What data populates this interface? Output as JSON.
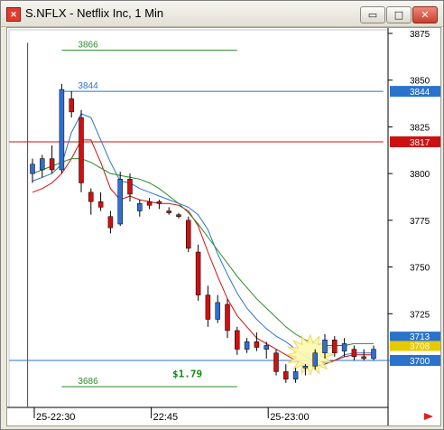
{
  "window": {
    "title": "S.NFLX - Netflix Inc, 1 Min",
    "app_icon_glyph": "✕",
    "minimize_glyph": "▭",
    "maximize_glyph": "□",
    "close_glyph": "✕"
  },
  "chart_data": {
    "type": "candlestick",
    "title": "S.NFLX - Netflix Inc, 1 Min",
    "ylim": [
      3680,
      3880
    ],
    "y_ticks": [
      3875,
      3850,
      3825,
      3800,
      3775,
      3750,
      3725
    ],
    "y_tick_labels": [
      "3875",
      "3850",
      "3825",
      "3800",
      "3775",
      "3750",
      "3725"
    ],
    "x_tick_labels": [
      "25-22:30",
      "22:45",
      "25-23:00"
    ],
    "x_tick_bar_index": [
      0,
      12,
      24
    ],
    "up_color": "#2f6fd0",
    "down_color": "#cc1111",
    "candles": [
      {
        "o": 3800,
        "h": 3808,
        "l": 3795,
        "c": 3805
      },
      {
        "o": 3802,
        "h": 3810,
        "l": 3798,
        "c": 3808
      },
      {
        "o": 3808,
        "h": 3815,
        "l": 3800,
        "c": 3802
      },
      {
        "o": 3802,
        "h": 3848,
        "l": 3800,
        "c": 3845
      },
      {
        "o": 3840,
        "h": 3844,
        "l": 3830,
        "c": 3833
      },
      {
        "o": 3830,
        "h": 3834,
        "l": 3790,
        "c": 3795
      },
      {
        "o": 3790,
        "h": 3792,
        "l": 3778,
        "c": 3785
      },
      {
        "o": 3785,
        "h": 3790,
        "l": 3780,
        "c": 3782
      },
      {
        "o": 3777,
        "h": 3780,
        "l": 3768,
        "c": 3771
      },
      {
        "o": 3773,
        "h": 3801,
        "l": 3772,
        "c": 3797
      },
      {
        "o": 3797,
        "h": 3800,
        "l": 3785,
        "c": 3789
      },
      {
        "o": 3780,
        "h": 3786,
        "l": 3777,
        "c": 3784
      },
      {
        "o": 3785,
        "h": 3787,
        "l": 3781,
        "c": 3783
      },
      {
        "o": 3785,
        "h": 3786,
        "l": 3781,
        "c": 3784
      },
      {
        "o": 3780,
        "h": 3782,
        "l": 3778,
        "c": 3779
      },
      {
        "o": 3778,
        "h": 3779,
        "l": 3776,
        "c": 3777
      },
      {
        "o": 3775,
        "h": 3777,
        "l": 3758,
        "c": 3760
      },
      {
        "o": 3758,
        "h": 3762,
        "l": 3732,
        "c": 3735
      },
      {
        "o": 3735,
        "h": 3740,
        "l": 3718,
        "c": 3722
      },
      {
        "o": 3722,
        "h": 3735,
        "l": 3720,
        "c": 3731
      },
      {
        "o": 3730,
        "h": 3733,
        "l": 3712,
        "c": 3716
      },
      {
        "o": 3716,
        "h": 3718,
        "l": 3703,
        "c": 3706
      },
      {
        "o": 3706,
        "h": 3712,
        "l": 3704,
        "c": 3710
      },
      {
        "o": 3710,
        "h": 3715,
        "l": 3705,
        "c": 3707
      },
      {
        "o": 3706,
        "h": 3710,
        "l": 3701,
        "c": 3708
      },
      {
        "o": 3704,
        "h": 3706,
        "l": 3692,
        "c": 3694
      },
      {
        "o": 3694,
        "h": 3698,
        "l": 3688,
        "c": 3690
      },
      {
        "o": 3690,
        "h": 3696,
        "l": 3688,
        "c": 3694
      },
      {
        "o": 3696,
        "h": 3698,
        "l": 3692,
        "c": 3697
      },
      {
        "o": 3697,
        "h": 3706,
        "l": 3695,
        "c": 3704
      },
      {
        "o": 3704,
        "h": 3714,
        "l": 3701,
        "c": 3711
      },
      {
        "o": 3711,
        "h": 3713,
        "l": 3702,
        "c": 3704
      },
      {
        "o": 3705,
        "h": 3712,
        "l": 3702,
        "c": 3709
      },
      {
        "o": 3706,
        "h": 3708,
        "l": 3700,
        "c": 3702
      },
      {
        "o": 3702,
        "h": 3706,
        "l": 3700,
        "c": 3701
      },
      {
        "o": 3701,
        "h": 3708,
        "l": 3700,
        "c": 3706
      }
    ],
    "ma_series": [
      {
        "color": "#2a73cc",
        "values": [
          3796,
          3798,
          3800,
          3805,
          3822,
          3832,
          3830,
          3818,
          3806,
          3796,
          3795,
          3792,
          3790,
          3788,
          3786,
          3784,
          3782,
          3778,
          3770,
          3757,
          3746,
          3736,
          3728,
          3722,
          3717,
          3713,
          3710,
          3706,
          3702,
          3700,
          3699,
          3700,
          3703,
          3704,
          3704,
          3704
        ]
      },
      {
        "color": "#cc1111",
        "values": [
          3790,
          3792,
          3795,
          3800,
          3808,
          3818,
          3818,
          3806,
          3792,
          3786,
          3788,
          3786,
          3785,
          3784,
          3784,
          3783,
          3780,
          3772,
          3758,
          3745,
          3733,
          3724,
          3718,
          3712,
          3709,
          3706,
          3703,
          3700,
          3698,
          3697,
          3698,
          3700,
          3702,
          3703,
          3703,
          3703
        ]
      },
      {
        "color": "#2a8a2a",
        "values": [
          3800,
          3802,
          3804,
          3806,
          3808,
          3808,
          3806,
          3803,
          3800,
          3799,
          3798,
          3797,
          3795,
          3792,
          3788,
          3784,
          3779,
          3773,
          3766,
          3759,
          3752,
          3745,
          3739,
          3733,
          3728,
          3723,
          3718,
          3714,
          3711,
          3709,
          3708,
          3708,
          3708,
          3709,
          3709,
          3709
        ]
      }
    ],
    "levels": [
      {
        "value": 3866,
        "color": "#2a8a2a",
        "label": "3866",
        "from_bar": 3,
        "to_bar": 21
      },
      {
        "value": 3844,
        "color": "#2a73cc",
        "label": "3844",
        "from_bar": 3,
        "to_bar": 36,
        "tag": "3844"
      },
      {
        "value": 3817,
        "color": "#cc1111",
        "label": "",
        "from_bar": -1,
        "to_bar": 36,
        "tag": "3817"
      },
      {
        "value": 3700,
        "color": "#2a73cc",
        "label": "",
        "from_bar": -1,
        "to_bar": 39,
        "tag": "3700"
      },
      {
        "value": 3686,
        "color": "#2a8a2a",
        "label": "3686",
        "from_bar": 3,
        "to_bar": 21
      }
    ],
    "price_tags": [
      {
        "value": 3713,
        "label": "3713",
        "color": "#2a73cc"
      },
      {
        "value": 3708,
        "label": "3708",
        "color": "#e8c800"
      }
    ],
    "annotation": {
      "text": "$1.79",
      "color": "#118811",
      "bar": 17.5,
      "value": 3693
    },
    "starburst": {
      "bar": 28.5,
      "value": 3703
    }
  }
}
